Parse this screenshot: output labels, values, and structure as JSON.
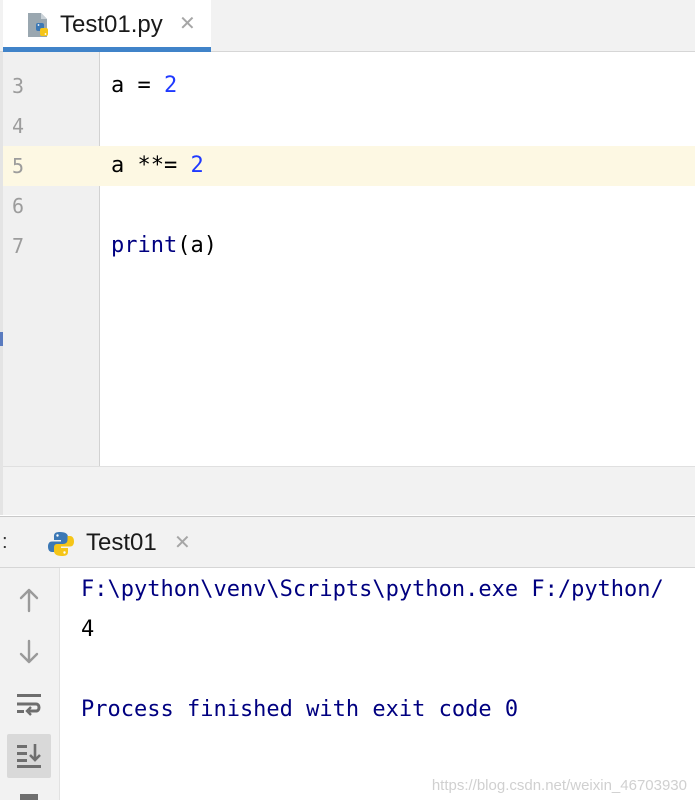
{
  "editor_tab": {
    "label": "Test01.py",
    "close": "✕"
  },
  "code": {
    "lines": [
      {
        "number": "3",
        "tokens": [
          "a = ",
          "2"
        ]
      },
      {
        "number": "4",
        "tokens": []
      },
      {
        "number": "5",
        "tokens": [
          "a **= ",
          "2"
        ],
        "current": true
      },
      {
        "number": "6",
        "tokens": []
      },
      {
        "number": "7",
        "tokens": [
          "print",
          "(a)"
        ]
      }
    ]
  },
  "run_window": {
    "prefix": ":",
    "tab_label": "Test01",
    "close": "✕",
    "toolbar": [
      "up-arrow-icon",
      "down-arrow-icon",
      "soft-wrap-icon",
      "scroll-to-end-icon"
    ],
    "console": [
      "F:\\python\\venv\\Scripts\\python.exe F:/python/",
      "4",
      "",
      "Process finished with exit code 0"
    ],
    "watermark": "https://blog.csdn.net/weixin_46703930"
  },
  "colors": {
    "accent": "#4083c9",
    "number": "#1f39ff",
    "console_system": "#000080",
    "current_line": "#fdf8e3"
  }
}
